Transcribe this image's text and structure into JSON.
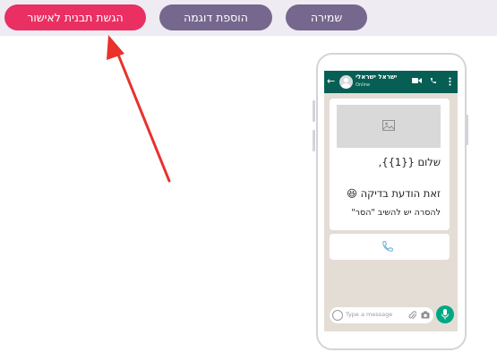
{
  "toolbar": {
    "submit_label": "הגשת תבנית לאישור",
    "add_sample_label": "הוספת דוגמה",
    "save_label": "שמירה"
  },
  "colors": {
    "submit_button": "#ea2f63",
    "secondary_button": "#76678e",
    "toolbar_bg": "#eeebf2",
    "arrow": "#e8322a",
    "whatsapp_header": "#075e54",
    "chat_bg": "#e4ddd5",
    "mic_button": "#00a884"
  },
  "preview": {
    "contact_name": "ישראל ישראלי",
    "contact_status": "Online",
    "message_lines": [
      "שלום {{1}},",
      "זאת הודעת בדיקה 😆",
      "להסרה יש להשיב \"הסר\""
    ],
    "input_placeholder": "Type a message",
    "icons": [
      "back-arrow-icon",
      "avatar-icon",
      "video-icon",
      "phone-icon",
      "menu-icon",
      "image-icon",
      "phone-icon",
      "emoji-icon",
      "attach-icon",
      "camera-icon",
      "mic-icon"
    ]
  }
}
